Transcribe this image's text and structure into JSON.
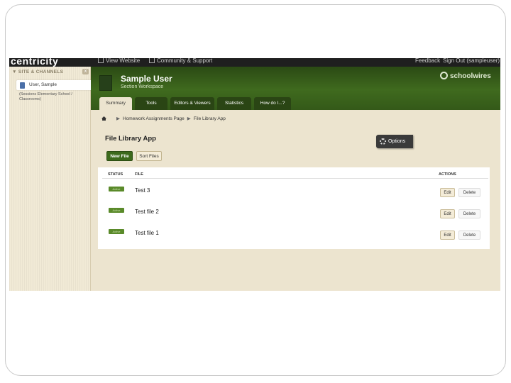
{
  "topbar": {
    "brand": "centricity",
    "view_website": "View Website",
    "community": "Community & Support",
    "feedback": "Feedback",
    "signout": "Sign Out (sampleuser)"
  },
  "sidebar": {
    "heading": "▼ SITE & CHANNELS",
    "close": "x",
    "user_item": "User, Sample",
    "sub_text": "(Sessions Elementary School / Classrooms)"
  },
  "header": {
    "title": "Sample User",
    "subtitle": "Section Workspace",
    "logo": "schoolwires"
  },
  "tabs": [
    {
      "label": "Summary"
    },
    {
      "label": "Tools"
    },
    {
      "label": "Editors & Viewers"
    },
    {
      "label": "Statistics"
    },
    {
      "label": "How do I...?"
    }
  ],
  "breadcrumb": {
    "items": [
      "Homework Assignments Page",
      "File Library App"
    ],
    "separator": "▶"
  },
  "page_title": "File Library App",
  "buttons": {
    "new_file": "New File",
    "sort_files": "Sort Files",
    "options": "Options"
  },
  "table": {
    "headers": {
      "status": "STATUS",
      "file": "FILE",
      "actions": "ACTIONS"
    },
    "rows": [
      {
        "status": "Active",
        "file": "Test 3",
        "edit": "Edit",
        "delete": "Delete"
      },
      {
        "status": "Active",
        "file": "Test file 2",
        "edit": "Edit",
        "delete": "Delete"
      },
      {
        "status": "Active",
        "file": "Test file 1",
        "edit": "Edit",
        "delete": "Delete"
      }
    ]
  },
  "colors": {
    "header_green": "#3f6a1e",
    "button_green": "#3d6a1c",
    "panel_beige": "#ece4cf"
  }
}
